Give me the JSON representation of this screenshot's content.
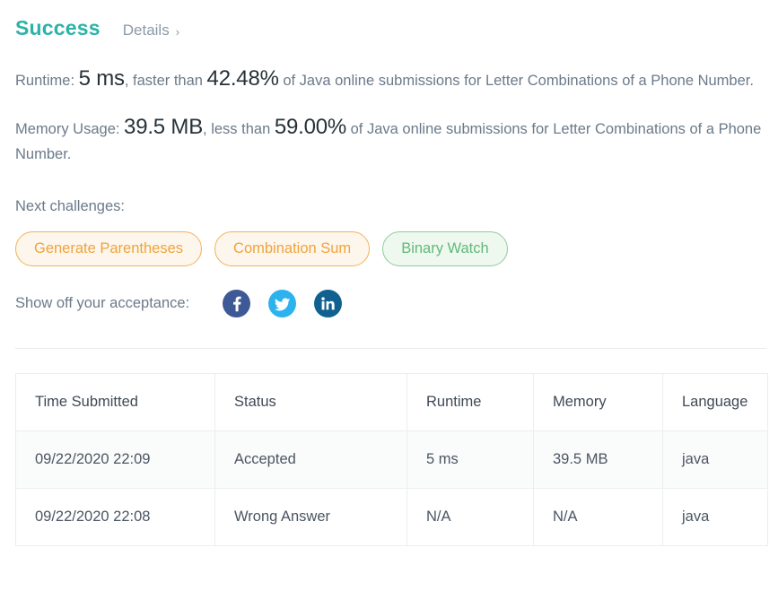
{
  "header": {
    "status_title": "Success",
    "details_label": "Details",
    "chevron_glyph": "›"
  },
  "stats": {
    "runtime": {
      "prefix": "Runtime: ",
      "value": "5 ms",
      "mid": ", faster than ",
      "percentile": "42.48%",
      "suffix": " of Java online submissions for Letter Combinations of a Phone Number."
    },
    "memory": {
      "prefix": "Memory Usage: ",
      "value": "39.5 MB",
      "mid": ", less than ",
      "percentile": "59.00%",
      "suffix": " of Java online submissions for Letter Combinations of a Phone Number."
    }
  },
  "next_challenges": {
    "label": "Next challenges:",
    "items": [
      {
        "label": "Generate Parentheses",
        "difficulty": "medium",
        "color": "#f0a33c"
      },
      {
        "label": "Combination Sum",
        "difficulty": "medium",
        "color": "#f0a33c"
      },
      {
        "label": "Binary Watch",
        "difficulty": "easy",
        "color": "#62b97a"
      }
    ]
  },
  "share": {
    "label": "Show off your acceptance:",
    "networks": [
      {
        "name": "facebook",
        "color": "#3d5a96"
      },
      {
        "name": "twitter",
        "color": "#2cb2ef"
      },
      {
        "name": "linkedin",
        "color": "#10618f"
      }
    ]
  },
  "submissions_table": {
    "columns": [
      "Time Submitted",
      "Status",
      "Runtime",
      "Memory",
      "Language"
    ],
    "rows": [
      {
        "time": "09/22/2020 22:09",
        "status": "Accepted",
        "status_state": "accepted",
        "runtime": "5 ms",
        "memory": "39.5 MB",
        "language": "java"
      },
      {
        "time": "09/22/2020 22:08",
        "status": "Wrong Answer",
        "status_state": "wrong",
        "runtime": "N/A",
        "memory": "N/A",
        "language": "java"
      }
    ]
  },
  "colors": {
    "success": "#2db3a6",
    "accepted": "#2a9d8f",
    "wrong_answer": "#c9384a",
    "medium": "#f0a33c",
    "easy": "#62b97a"
  }
}
